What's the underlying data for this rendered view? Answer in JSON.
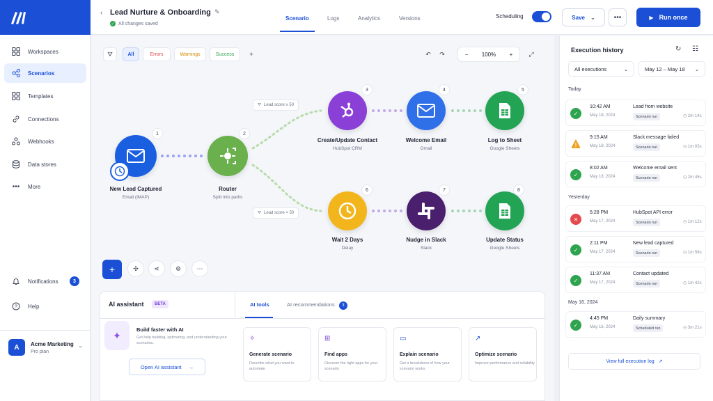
{
  "sidebar": {
    "items": [
      {
        "label": "Workspaces",
        "icon": "grid-icon"
      },
      {
        "label": "Scenarios",
        "icon": "share-nodes-icon"
      },
      {
        "label": "Templates",
        "icon": "grid-icon"
      },
      {
        "label": "Connections",
        "icon": "link-icon"
      },
      {
        "label": "Webhooks",
        "icon": "webhook-icon"
      },
      {
        "label": "Data stores",
        "icon": "database-icon"
      },
      {
        "label": "More",
        "icon": "dots-icon"
      }
    ],
    "notifications": {
      "label": "Notifications",
      "count": "3"
    },
    "help": "Help",
    "org": {
      "initial": "A",
      "name": "Acme Marketing",
      "plan": "Pro plan"
    }
  },
  "header": {
    "title": "Lead Nurture & Onboarding",
    "saved": "All changes saved",
    "tabs": [
      "Scenario",
      "Logs",
      "Analytics",
      "Versions"
    ],
    "scheduling": "Scheduling",
    "save": "Save",
    "run": "Run once"
  },
  "toolbar": {
    "filters": [
      "All",
      "Errors",
      "Warnings",
      "Success"
    ],
    "zoom": "100%"
  },
  "nodes": [
    {
      "num": "1",
      "name": "New Lead Captured",
      "sub": "Email (IMAP)"
    },
    {
      "num": "2",
      "name": "Router",
      "sub": "Split into paths"
    },
    {
      "num": "3",
      "name": "Create/Update Contact",
      "sub": "HubSpot CRM"
    },
    {
      "num": "4",
      "name": "Welcome Email",
      "sub": "Gmail"
    },
    {
      "num": "5",
      "name": "Log to Sheet",
      "sub": "Google Sheets"
    },
    {
      "num": "6",
      "name": "Wait 2 Days",
      "sub": "Delay"
    },
    {
      "num": "7",
      "name": "Nudge in Slack",
      "sub": "Slack"
    },
    {
      "num": "8",
      "name": "Update Status",
      "sub": "Google Sheets"
    }
  ],
  "conditions": {
    "top": "Lead score ≥ 50",
    "bottom": "Lead score < 50"
  },
  "ai": {
    "title": "AI assistant",
    "beta": "BETA",
    "tabs": [
      "AI tools",
      "AI recommendations"
    ],
    "rec_count": "3",
    "build_title": "Build faster with AI",
    "build_desc": "Get help building, optimizing, and understanding your scenarios.",
    "open": "Open AI assistant",
    "cards": [
      {
        "title": "Generate scenario",
        "desc": "Describe what you want to automate"
      },
      {
        "title": "Find apps",
        "desc": "Discover the right apps for your scenario"
      },
      {
        "title": "Explain scenario",
        "desc": "Get a breakdown of how your scenario works"
      },
      {
        "title": "Optimize scenario",
        "desc": "Improve performance and reliability"
      }
    ]
  },
  "history": {
    "title": "Execution history",
    "filter": "All executions",
    "range": "May 12 – May 18",
    "groups": [
      {
        "label": "Today",
        "items": [
          {
            "time": "10:42 AM",
            "date": "May 18, 2024",
            "event": "Lead from website",
            "tag": "Scenario run",
            "dur": "2m 14s",
            "status": "success"
          },
          {
            "time": "9:15 AM",
            "date": "May 18, 2024",
            "event": "Slack message failed",
            "tag": "Scenario run",
            "dur": "1m 03s",
            "status": "warning"
          },
          {
            "time": "8:02 AM",
            "date": "May 18, 2024",
            "event": "Welcome email sent",
            "tag": "Scenario run",
            "dur": "2m 45s",
            "status": "success"
          }
        ]
      },
      {
        "label": "Yesterday",
        "items": [
          {
            "time": "5:28 PM",
            "date": "May 17, 2024",
            "event": "HubSpot API error",
            "tag": "Scenario run",
            "dur": "1m 12s",
            "status": "error"
          },
          {
            "time": "2:11 PM",
            "date": "May 17, 2024",
            "event": "New lead captured",
            "tag": "Scenario run",
            "dur": "1m 58s",
            "status": "success"
          },
          {
            "time": "11:37 AM",
            "date": "May 17, 2024",
            "event": "Contact updated",
            "tag": "Scenario run",
            "dur": "1m 42s",
            "status": "success"
          }
        ]
      },
      {
        "label": "May 16, 2024",
        "items": [
          {
            "time": "4:45 PM",
            "date": "May 16, 2024",
            "event": "Daily summary",
            "tag": "Scheduled run",
            "dur": "3m 21s",
            "status": "success"
          }
        ]
      }
    ],
    "view_all": "View full execution log"
  },
  "colors": {
    "accent": "#1a4fd6",
    "success": "#2ea44f",
    "warning": "#f0a020",
    "error": "#e5484d"
  }
}
